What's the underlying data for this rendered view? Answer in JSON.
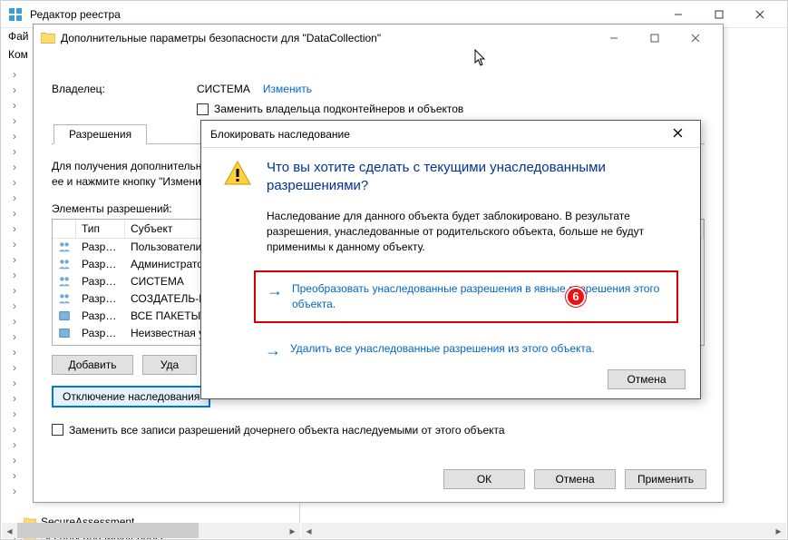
{
  "reg": {
    "title": "Редактор реестра",
    "menu_file": "Фай",
    "address_prefix": "Ком",
    "tree": [
      "",
      "",
      "",
      "",
      "",
      "",
      "",
      "",
      "",
      "",
      "",
      "",
      "",
      "",
      "",
      "",
      "",
      "",
      "",
      "",
      "",
      "",
      "",
      "",
      "",
      "",
      "",
      "",
      "",
      "SecureAssessment",
      "Security and Maintenance"
    ]
  },
  "adv": {
    "title": "Дополнительные параметры безопасности  для \"DataCollection\"",
    "owner_label": "Владелец:",
    "owner_value": "СИСТЕМА",
    "change": "Изменить",
    "replace_owner": "Заменить владельца подконтейнеров и объектов",
    "tab_perm": "Разрешения",
    "hint": "Для получения дополнительн\nее и нажмите кнопку \"Измени",
    "perm_head": "Элементы разрешений:",
    "cols": {
      "type": "Тип",
      "subject": "Субъект"
    },
    "rows": [
      {
        "type": "Разр…",
        "subj": "Пользователи (D"
      },
      {
        "type": "Разр…",
        "subj": "Администраторы"
      },
      {
        "type": "Разр…",
        "subj": "СИСТЕМА"
      },
      {
        "type": "Разр…",
        "subj": "СОЗДАТЕЛЬ-ВЛ"
      },
      {
        "type": "Разр…",
        "subj": "ВСЕ ПАКЕТЫ ПР"
      },
      {
        "type": "Разр…",
        "subj": "Неизвестная уче"
      }
    ],
    "add": "Добавить",
    "remove": "Уда",
    "disable_inh": "Отключение наследования",
    "replace_child": "Заменить все записи разрешений дочернего объекта наследуемыми от этого объекта",
    "ok": "ОК",
    "cancel": "Отмена",
    "apply": "Применить"
  },
  "dlg": {
    "title": "Блокировать наследование",
    "question": "Что вы хотите сделать с текущими унаследованными разрешениями?",
    "explain": "Наследование для данного объекта будет заблокировано. В результате разрешения, унаследованные от родительского объекта, больше не будут применимы к данному объекту.",
    "opt1": "Преобразовать унаследованные разрешения в явные разрешения этого объекта.",
    "opt2": "Удалить все унаследованные разрешения из этого объекта.",
    "cancel": "Отмена",
    "callout": "6"
  }
}
